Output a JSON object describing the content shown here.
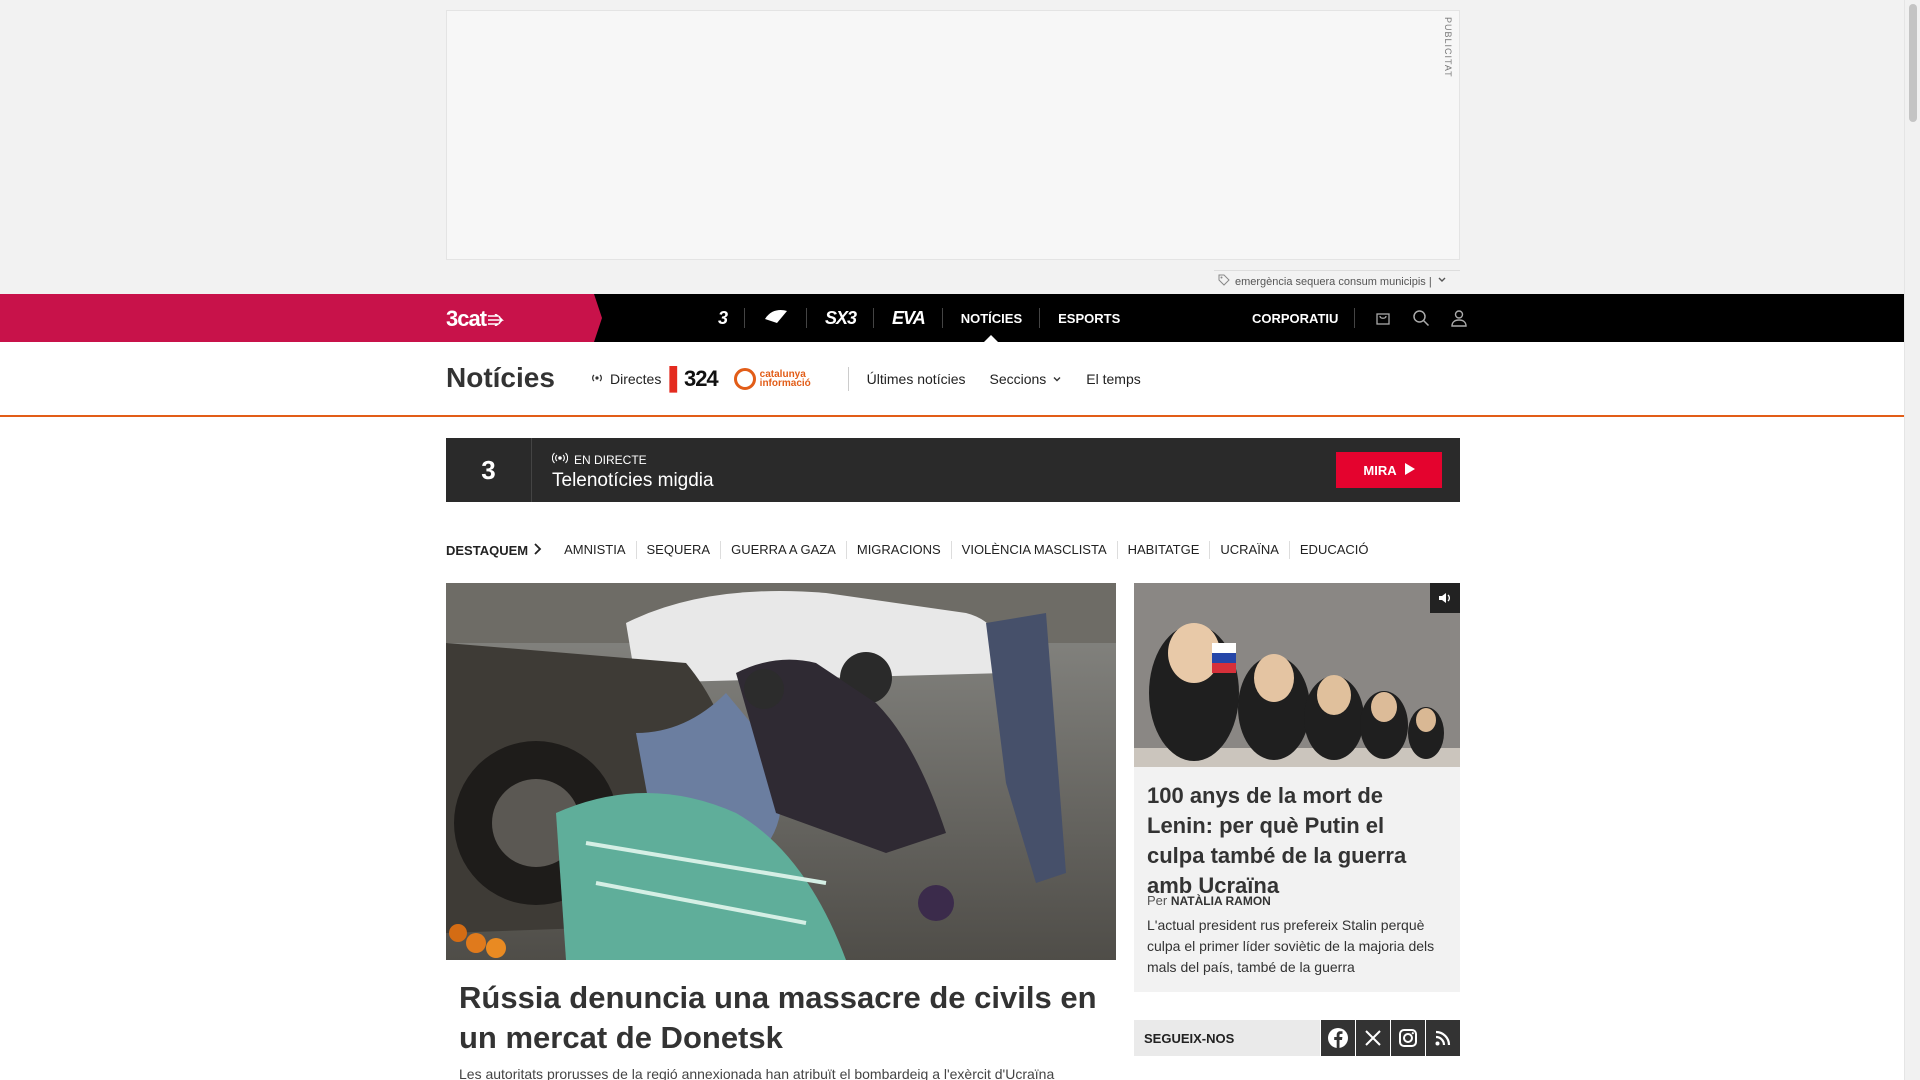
{
  "ad": {
    "label": "PUBLICITAT",
    "keywords": "emergència sequera consum municipis |"
  },
  "topbar": {
    "brand": "3cat",
    "channels": [
      {
        "label": "3",
        "type": "logo"
      },
      {
        "label": "Cat Ràdio",
        "type": "logo"
      },
      {
        "label": "SX3",
        "type": "logo"
      },
      {
        "label": "EVA",
        "type": "logo"
      },
      {
        "label": "NOTÍCIES",
        "type": "text",
        "active": true
      },
      {
        "label": "ESPORTS",
        "type": "text"
      }
    ],
    "corporate": "CORPORATIU",
    "icons": [
      "shopping-bag-icon",
      "search-icon",
      "user-icon"
    ]
  },
  "section": {
    "title": "Notícies",
    "directes": "Directes",
    "logo_324": "324",
    "logo_ci": "catalunya informació",
    "links": [
      "Últimes notícies",
      "Seccions",
      "El temps"
    ]
  },
  "live": {
    "channel": "3",
    "tag": "EN DIRECTE",
    "title": "Telenotícies migdia",
    "button": "MIRA"
  },
  "destaquem": {
    "title": "DESTAQUEM",
    "items": [
      "AMNISTIA",
      "SEQUERA",
      "GUERRA A GAZA",
      "MIGRACIONS",
      "VIOLÈNCIA MASCLISTA",
      "HABITATGE",
      "UCRAÏNA",
      "EDUCACIÓ"
    ]
  },
  "main_story": {
    "title": "Rússia denuncia una massacre de civils en un mercat de Donetsk",
    "lead": "Les autoritats prorusses de la regió annexionada han atribuït el bombardeig a l'exèrcit d'Ucraïna"
  },
  "side_story": {
    "title": "100 anys de la mort de Lenin: per què Putin el culpa també de la guerra amb Ucraïna",
    "author_prefix": "Per",
    "author": "NATÀLIA RAMON",
    "lead": "L'actual president rus prefereix Stalin perquè culpa el primer líder soviètic de la majoria dels mals del país, també de la guerra"
  },
  "follow": {
    "label": "SEGUEIX-NOS",
    "networks": [
      "facebook-icon",
      "x-icon",
      "instagram-icon",
      "rss-icon"
    ]
  },
  "colors": {
    "brand": "#c8124a",
    "accent": "#e25d18",
    "live_button": "#e4032e"
  }
}
